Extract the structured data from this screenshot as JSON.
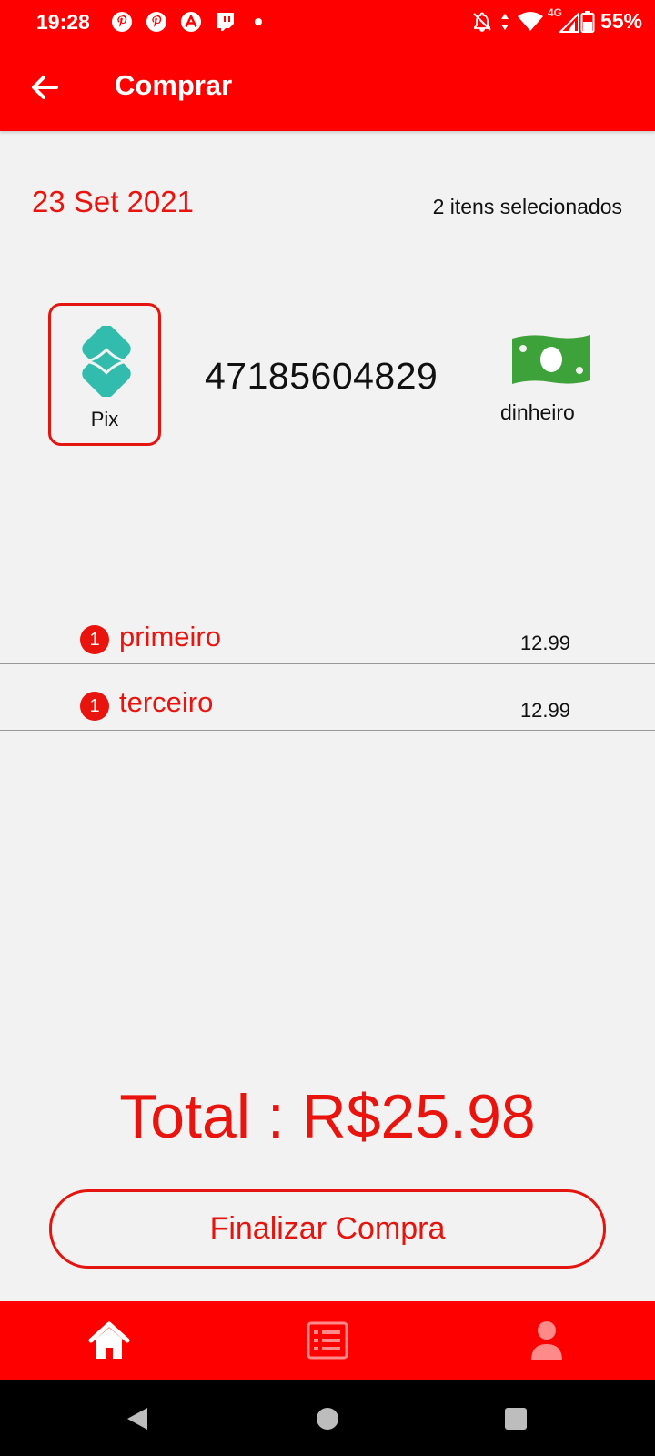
{
  "status_bar": {
    "time": "19:28",
    "battery": "55%",
    "network": "4G",
    "notification_icons": [
      "pinterest-icon",
      "pinterest-icon",
      "arc-icon",
      "twitch-icon"
    ]
  },
  "app_bar": {
    "title": "Comprar"
  },
  "order": {
    "date": "23 Set 2021",
    "items_count": "2 itens selecionados"
  },
  "payment": {
    "pix_label": "Pix",
    "pix_key": "47185604829",
    "cash_label": "dinheiro"
  },
  "items": [
    {
      "qty": "1",
      "name": "primeiro",
      "price": "12.99"
    },
    {
      "qty": "1",
      "name": "terceiro",
      "price": "12.99"
    }
  ],
  "total": "Total : R$25.98",
  "finalize_label": "Finalizar Compra",
  "bottom_nav": [
    {
      "icon": "home-icon",
      "active": true
    },
    {
      "icon": "list-icon",
      "active": false
    },
    {
      "icon": "user-icon",
      "active": false
    }
  ],
  "colors": {
    "primary": "#fe0000",
    "accent_text": "#e8140d",
    "background": "#f2f2f2",
    "pix": "#32bcad",
    "cash": "#3ea23a"
  }
}
